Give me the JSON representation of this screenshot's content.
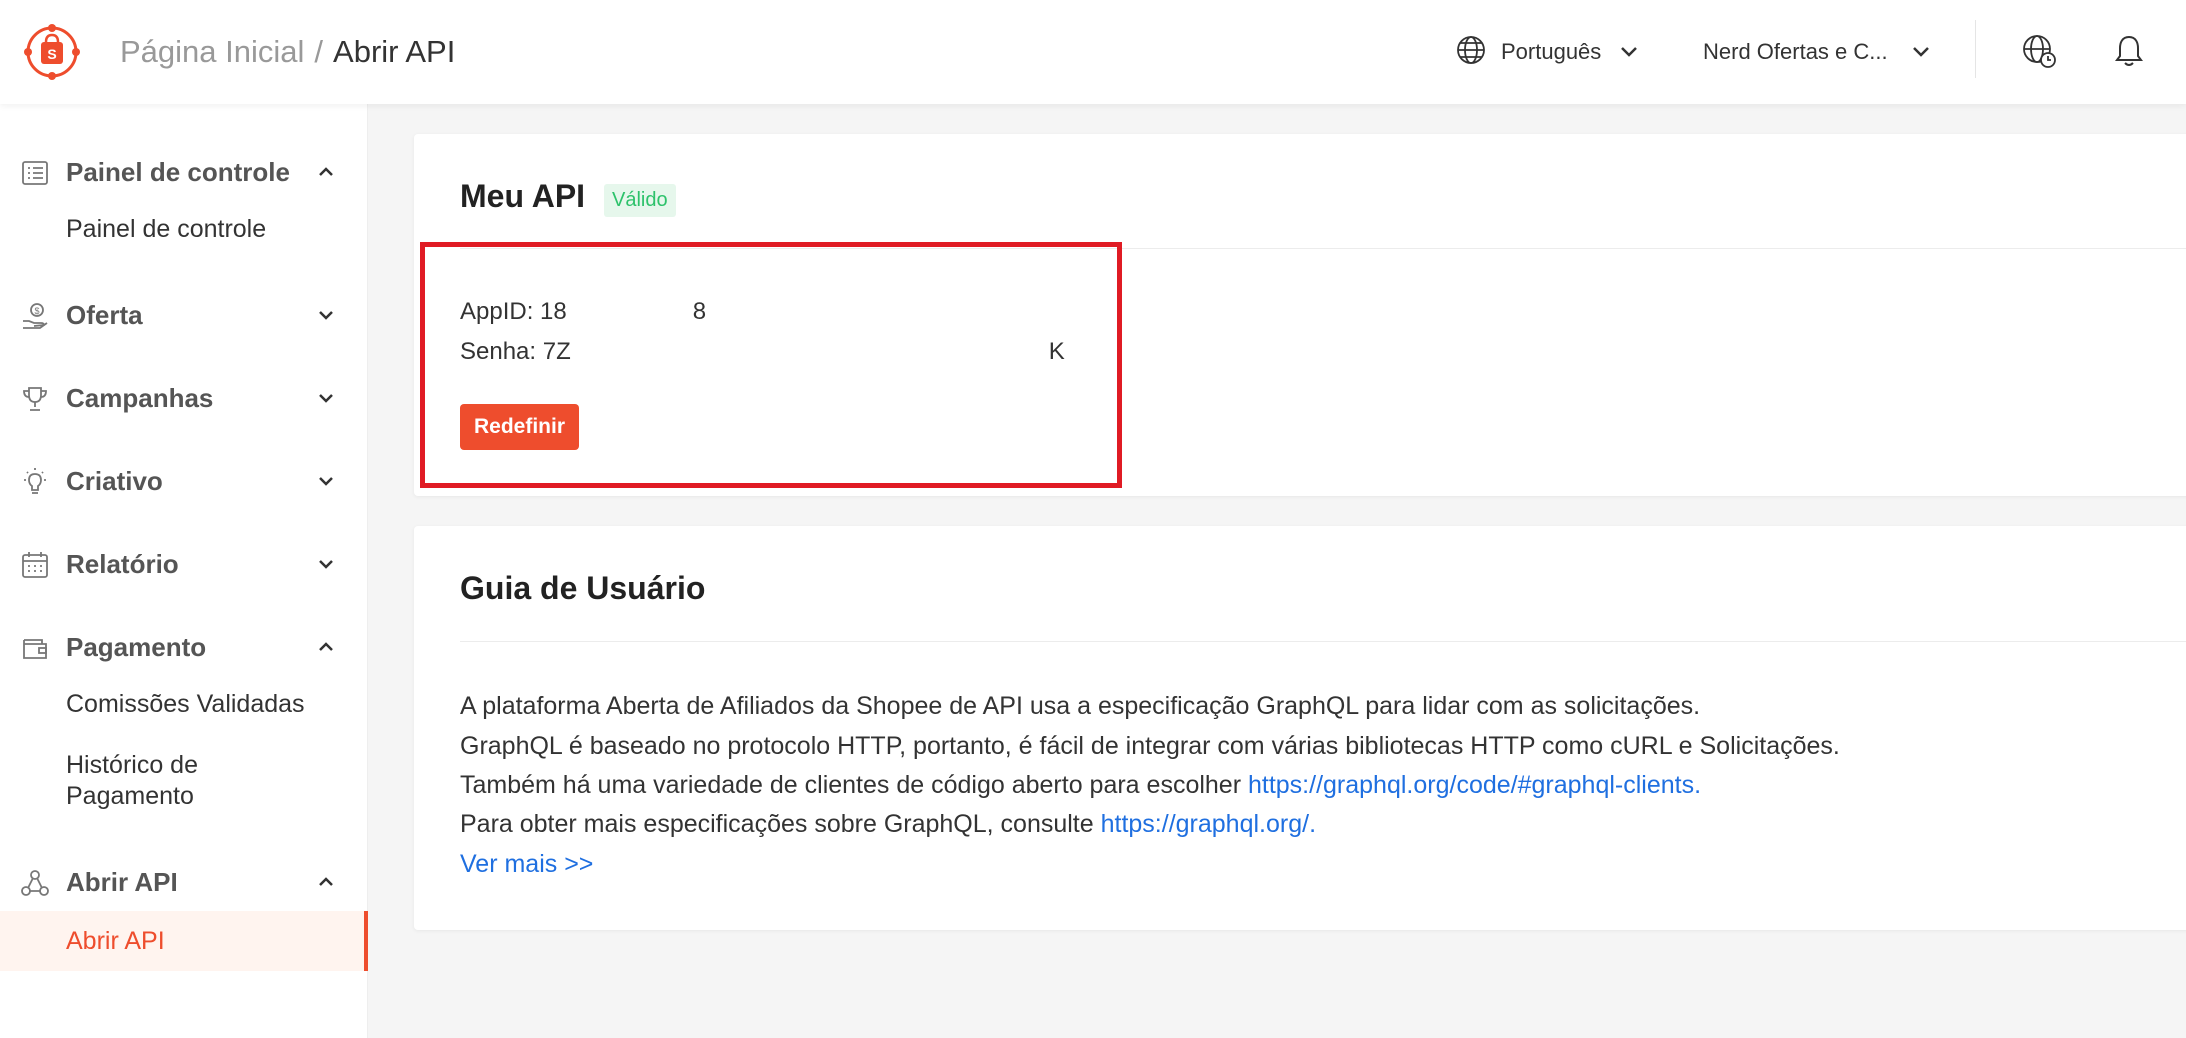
{
  "header": {
    "breadcrumb_home": "Página Inicial",
    "breadcrumb_sep": "/",
    "breadcrumb_current": "Abrir API",
    "language": "Português",
    "account": "Nerd Ofertas e C..."
  },
  "sidebar": {
    "groups": [
      {
        "label": "Painel de controle",
        "icon": "list-icon",
        "expanded": true,
        "items": [
          "Painel de controle"
        ]
      },
      {
        "label": "Oferta",
        "icon": "hand-coin-icon",
        "expanded": false,
        "items": []
      },
      {
        "label": "Campanhas",
        "icon": "trophy-icon",
        "expanded": false,
        "items": []
      },
      {
        "label": "Criativo",
        "icon": "lightbulb-icon",
        "expanded": false,
        "items": []
      },
      {
        "label": "Relatório",
        "icon": "calendar-icon",
        "expanded": false,
        "items": []
      },
      {
        "label": "Pagamento",
        "icon": "wallet-icon",
        "expanded": true,
        "items": [
          "Comissões Validadas",
          "Histórico de",
          "Pagamento"
        ]
      },
      {
        "label": "Abrir API",
        "icon": "network-icon",
        "expanded": true,
        "items": [
          "Abrir API"
        ]
      }
    ],
    "active_item": "Abrir API"
  },
  "api_card": {
    "title": "Meu API",
    "status_badge": "Válido",
    "app_id_label": "AppID: 18",
    "app_id_tail": "8",
    "secret_label": "Senha: 7Z",
    "secret_tail": "K",
    "reset_button": "Redefinir"
  },
  "guide_card": {
    "title": "Guia de Usuário",
    "lines": [
      "A plataforma Aberta de Afiliados da Shopee de API usa a especificação GraphQL para lidar com as solicitações.",
      "GraphQL é baseado no protocolo HTTP, portanto, é fácil de integrar com várias bibliotecas HTTP como cURL e Solicitações.",
      "Também há uma variedade de clientes de código aberto para escolher ",
      "Para obter mais especificações sobre GraphQL, consulte "
    ],
    "link_clients": "https://graphql.org/code/#graphql-clients.",
    "link_spec": "https://graphql.org/.",
    "see_more": "Ver mais >>"
  },
  "colors": {
    "brand": "#ee4d2d",
    "link": "#1f6fe0",
    "valid_text": "#2dc26b",
    "valid_bg": "#e6f7ec",
    "highlight_border": "#e01b24"
  }
}
